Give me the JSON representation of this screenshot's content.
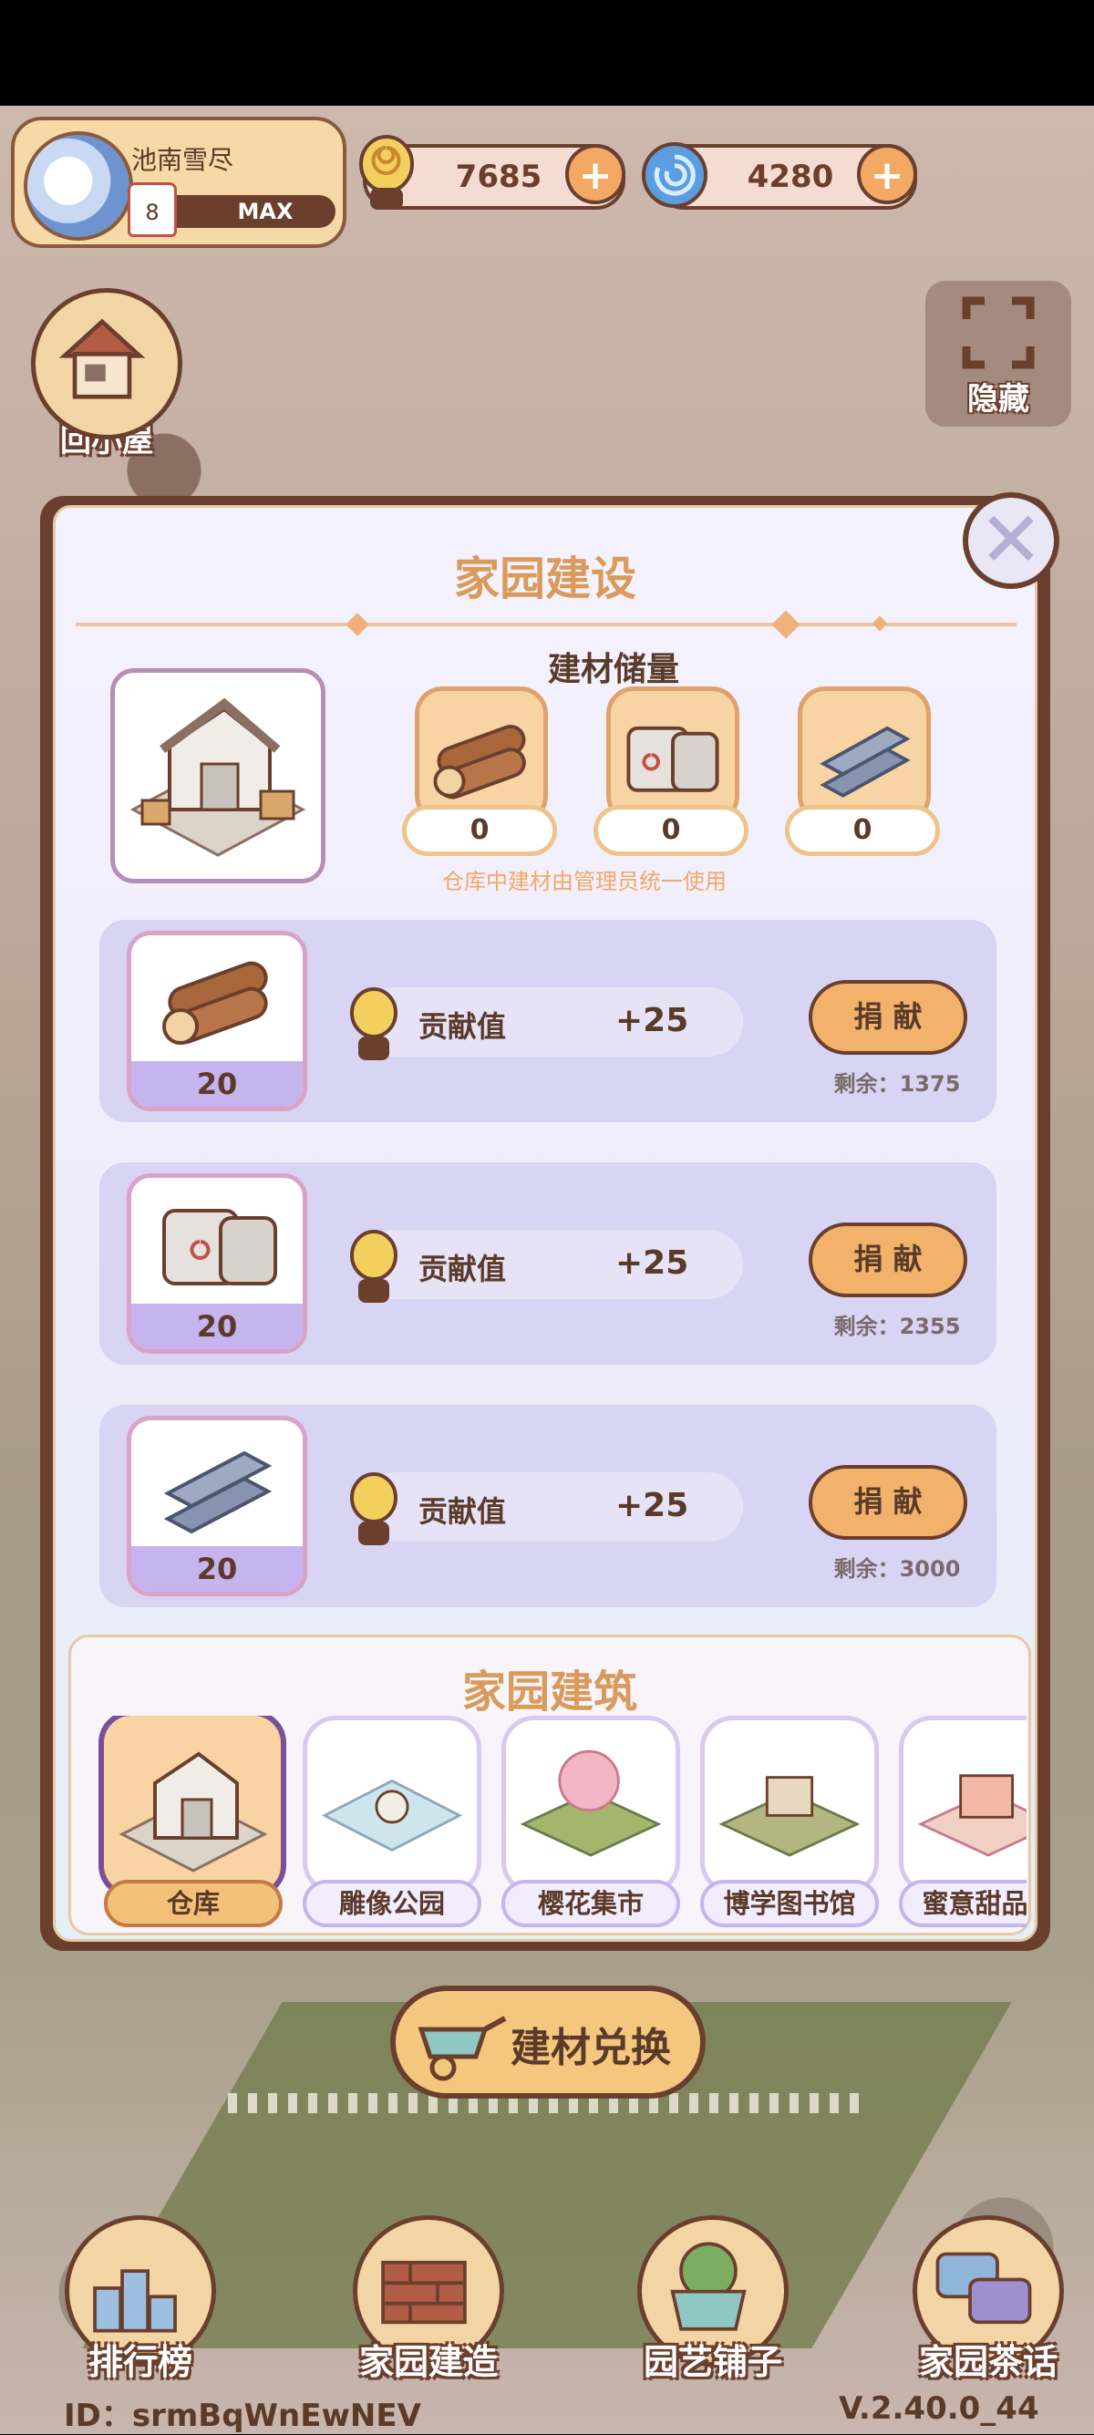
{
  "hud": {
    "player_name": "池南雪尽",
    "level": "8",
    "level_status": "MAX",
    "currency_snail": "7685",
    "currency_swirl": "4280",
    "back_home_label": "回小屋",
    "hide_label": "隐藏"
  },
  "modal": {
    "title": "家园建设",
    "stock_title": "建材储量",
    "stock": [
      {
        "icon": "wood-logs-icon",
        "count": "0"
      },
      {
        "icon": "cement-bags-icon",
        "count": "0"
      },
      {
        "icon": "steel-beams-icon",
        "count": "0"
      }
    ],
    "note": "仓库中建材由管理员统一使用",
    "donations": [
      {
        "icon": "wood-logs-icon",
        "qty": "20",
        "label": "贡献值",
        "amount": "+25",
        "button": "捐 献",
        "remain": "剩余：1375"
      },
      {
        "icon": "cement-bags-icon",
        "qty": "20",
        "label": "贡献值",
        "amount": "+25",
        "button": "捐 献",
        "remain": "剩余：2355"
      },
      {
        "icon": "steel-beams-icon",
        "qty": "20",
        "label": "贡献值",
        "amount": "+25",
        "button": "捐 献",
        "remain": "剩余：3000"
      }
    ],
    "buildings_title": "家园建筑",
    "buildings": [
      {
        "name": "仓库",
        "selected": true
      },
      {
        "name": "雕像公园",
        "selected": false
      },
      {
        "name": "樱花集市",
        "selected": false
      },
      {
        "name": "博学图书馆",
        "selected": false
      },
      {
        "name": "蜜意甜品屋",
        "selected": false
      }
    ]
  },
  "exchange_label": "建材兑换",
  "nav": [
    {
      "label": "排行榜",
      "icon": "trophy-icon"
    },
    {
      "label": "家园建造",
      "icon": "bricks-icon"
    },
    {
      "label": "园艺铺子",
      "icon": "flower-pot-icon"
    },
    {
      "label": "家园茶话",
      "icon": "chat-icon"
    }
  ],
  "footer": {
    "id": "ID：srmBqWnEwNEV",
    "version": "V.2.40.0_44"
  },
  "colors": {
    "accent_orange": "#f2b26c",
    "frame_brown": "#6b3f2e",
    "title_orange": "#d99a5a",
    "panel_lavender": "#d8d5f4"
  }
}
